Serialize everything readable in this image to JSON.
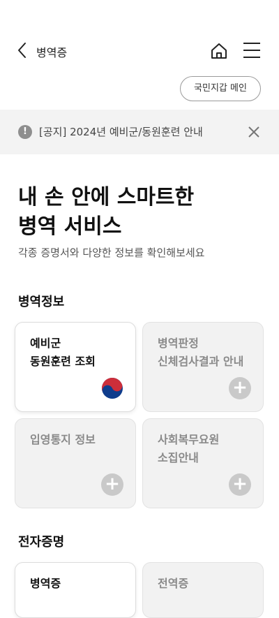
{
  "header": {
    "title": "병역증",
    "back_icon": "chevron-left-icon",
    "home_icon": "home-icon",
    "menu_icon": "hamburger-menu-icon"
  },
  "wallet_button": {
    "label": "국민지갑 메인"
  },
  "notice": {
    "icon": "info-icon",
    "icon_glyph": "!",
    "text": "[공지] 2024년 예비군/동원훈련 안내",
    "close_icon": "close-icon"
  },
  "hero": {
    "headline_line1": "내 손 안에 스마트한",
    "headline_line2": "병역 서비스",
    "subtitle": "각종 증명서와 다양한 정보를 확인해보세요"
  },
  "sections": {
    "military_info": {
      "title": "병역정보",
      "cards": [
        {
          "label": "예비군\n동원훈련 조회",
          "state": "active",
          "icon": "taegeuk-icon"
        },
        {
          "label": "병역판정\n신체검사결과 안내",
          "state": "inactive",
          "icon": "plus-icon",
          "icon_glyph": "+"
        },
        {
          "label": "입영통지 정보",
          "state": "inactive",
          "icon": "plus-icon",
          "icon_glyph": "+"
        },
        {
          "label": "사회복무요원\n소집안내",
          "state": "inactive",
          "icon": "plus-icon",
          "icon_glyph": "+"
        }
      ]
    },
    "e_certificates": {
      "title": "전자증명",
      "cards": [
        {
          "label": "병역증",
          "state": "active"
        },
        {
          "label": "전역증",
          "state": "inactive"
        }
      ]
    }
  },
  "colors": {
    "notice_bg": "#f3f3f3",
    "inactive_card_bg": "#f2f2f2",
    "inactive_text": "#8a8a8a",
    "taegeuk_red": "#cd2e3a",
    "taegeuk_blue": "#0f3c8c"
  }
}
